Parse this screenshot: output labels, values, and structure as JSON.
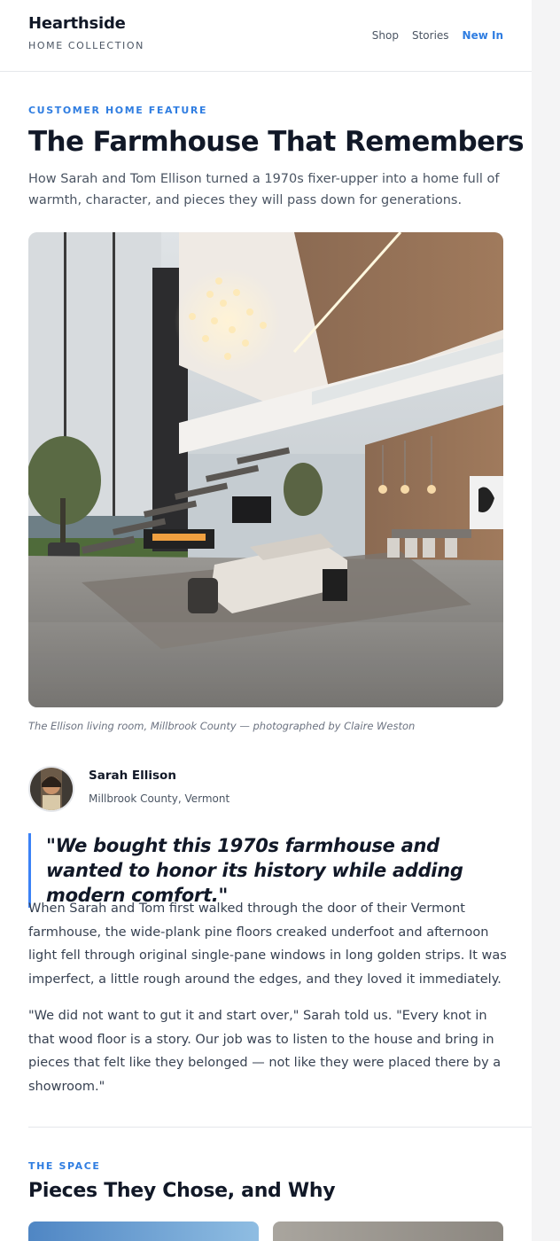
{
  "header": {
    "brand_name": "Hearthside",
    "brand_sub": "HOME COLLECTION",
    "nav": [
      "Shop",
      "Stories",
      "New In"
    ],
    "active_nav": "New In"
  },
  "article": {
    "eyebrow": "CUSTOMER HOME FEATURE",
    "title": "The Farmhouse That Remembers",
    "dek": "How Sarah and Tom Ellison turned a 1970s fixer-upper into a home full of warmth, character, and pieces they will pass down for generations.",
    "caption": "The Ellison living room, Millbrook County — photographed by Claire Weston",
    "author": {
      "name": "Sarah Ellison",
      "location": "Millbrook County, Vermont"
    },
    "pullquote": "\"We bought this 1970s farmhouse and wanted to honor its history while adding modern comfort.\"",
    "paragraphs": [
      "When Sarah and Tom first walked through the door of their Vermont farmhouse, the wide-plank pine floors creaked underfoot and afternoon light fell through original single-pane windows in long golden strips. It was imperfect, a little rough around the edges, and they loved it immediately.",
      "\"We did not want to gut it and start over,\" Sarah told us. \"Every knot in that wood floor is a story. Our job was to listen to the house and bring in pieces that felt like they belonged — not like they were placed there by a showroom.\""
    ]
  },
  "section": {
    "eyebrow": "THE SPACE",
    "title": "Pieces They Chose, and Why"
  },
  "colors": {
    "accent": "#2f7de1",
    "quote_rule": "#3b82f6"
  }
}
